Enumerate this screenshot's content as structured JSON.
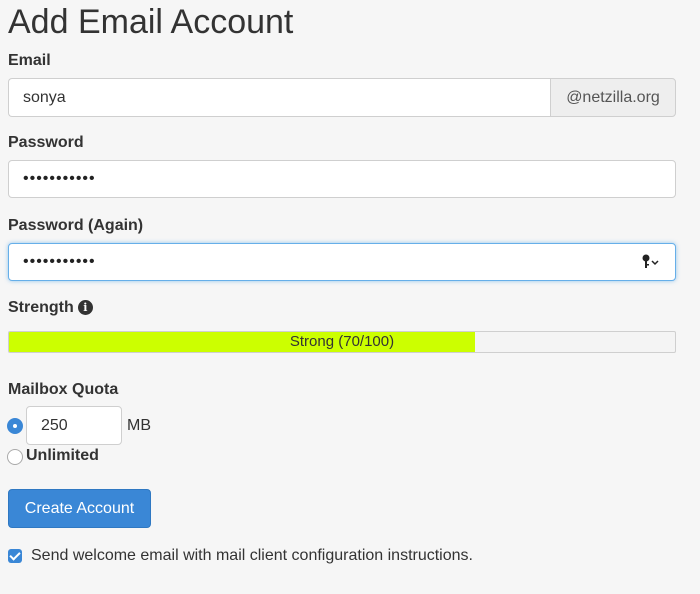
{
  "page": {
    "title": "Add Email Account"
  },
  "email": {
    "label": "Email",
    "value": "sonya",
    "domain": "@netzilla.org"
  },
  "password": {
    "label": "Password",
    "value": "•••••••••••"
  },
  "password_again": {
    "label": "Password (Again)",
    "value": "•••••••••••",
    "icon": "key-icon"
  },
  "strength": {
    "label": "Strength",
    "text": "Strong (70/100)",
    "score": 70,
    "max": 100,
    "bar_color": "#ccff00",
    "info_icon": "info-icon"
  },
  "quota": {
    "label": "Mailbox Quota",
    "value": "250",
    "unit": "MB",
    "unlimited_label": "Unlimited",
    "selected": "limited"
  },
  "actions": {
    "create_label": "Create Account"
  },
  "welcome": {
    "label": "Send welcome email with mail client configuration instructions.",
    "checked": true
  },
  "colors": {
    "accent": "#3a87d6",
    "background": "#f6f6f6"
  }
}
